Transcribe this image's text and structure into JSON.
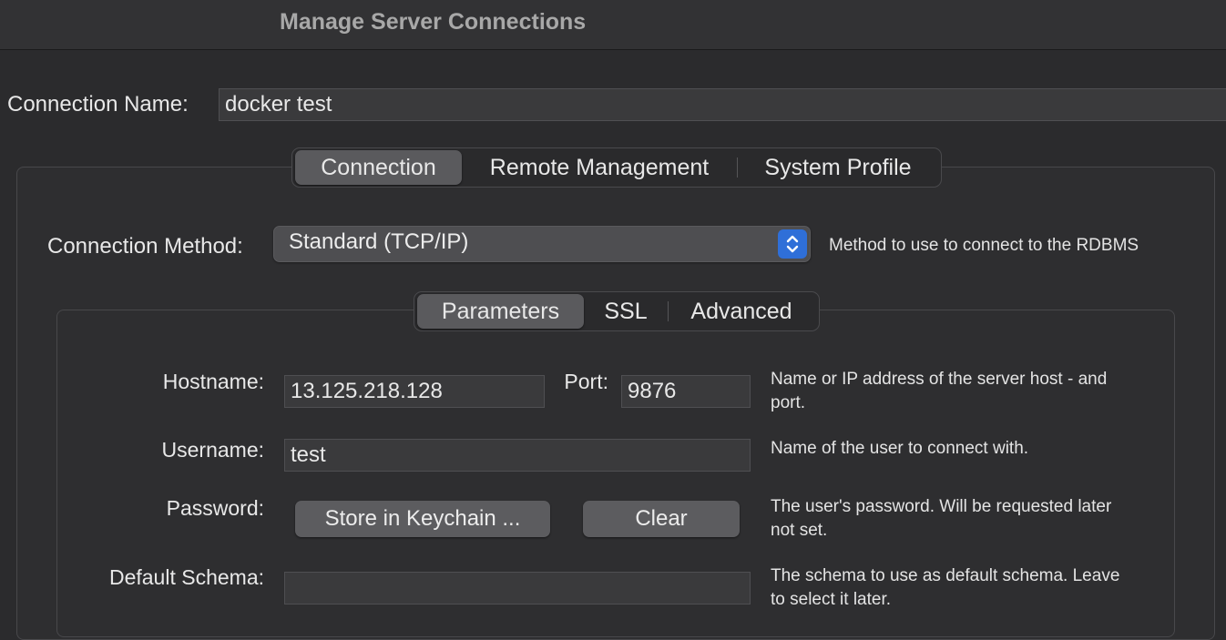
{
  "window": {
    "title": "Manage Server Connections"
  },
  "connection_name": {
    "label": "Connection Name:",
    "value": "docker test"
  },
  "main_tabs": [
    {
      "label": "Connection",
      "selected": true
    },
    {
      "label": "Remote Management",
      "selected": false
    },
    {
      "label": "System Profile",
      "selected": false
    }
  ],
  "connection_method": {
    "label": "Connection Method:",
    "value": "Standard (TCP/IP)",
    "help": "Method to use to connect to the RDBMS"
  },
  "sub_tabs": [
    {
      "label": "Parameters",
      "selected": true
    },
    {
      "label": "SSL",
      "selected": false
    },
    {
      "label": "Advanced",
      "selected": false
    }
  ],
  "parameters": {
    "hostname": {
      "label": "Hostname:",
      "value": "13.125.218.128"
    },
    "port": {
      "label": "Port:",
      "value": "9876"
    },
    "hostname_help": [
      "Name or IP address of the server host - and ",
      "port."
    ],
    "username": {
      "label": "Username:",
      "value": "test",
      "help": "Name of the user to connect with."
    },
    "password": {
      "label": "Password:",
      "store_button": "Store in Keychain ...",
      "clear_button": "Clear",
      "help": [
        "The user's password. Will be requested later",
        "not set."
      ]
    },
    "default_schema": {
      "label": "Default Schema:",
      "value": "",
      "help": [
        "The schema to use as default schema. Leave",
        "to select it later."
      ]
    }
  },
  "colors": {
    "accent": "#2f6fd8",
    "background": "#2b2b2d"
  }
}
